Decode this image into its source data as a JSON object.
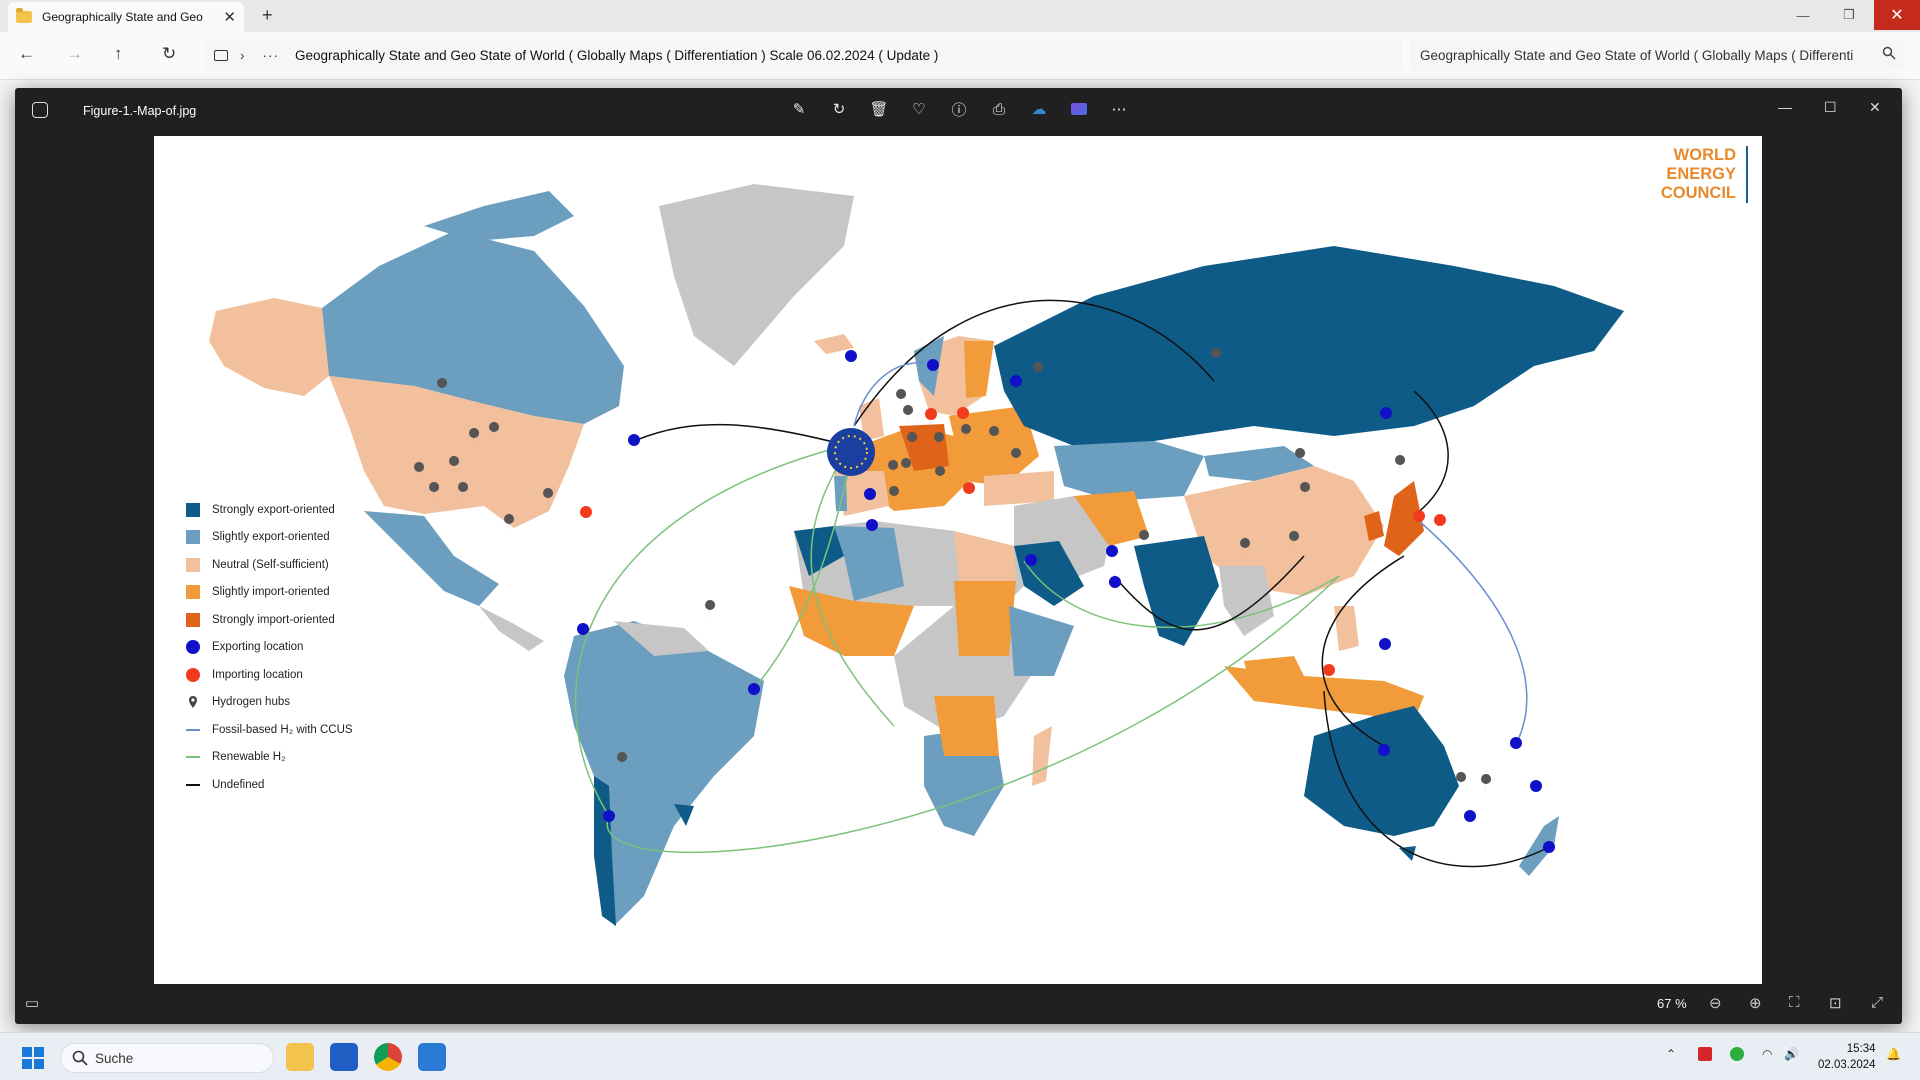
{
  "explorer": {
    "tab_title": "Geographically State and Geo",
    "address": "Geographically State and Geo State of World ( Globally Maps ( Differentiation ) Scale 06.02.2024 ( Update )",
    "search_text": "Geographically State and Geo State of World ( Globally Maps ( Differenti"
  },
  "viewer": {
    "filename": "Figure-1.-Map-of.jpg",
    "zoom": "67 %",
    "toolbar_icons": [
      "edit-image-icon",
      "rotate-icon",
      "delete-icon",
      "favorite-icon",
      "info-icon",
      "print-icon",
      "onedrive-icon",
      "clipchamp-icon",
      "more-icon"
    ]
  },
  "map": {
    "logo_lines": [
      "WORLD",
      "ENERGY",
      "COUNCIL"
    ],
    "legend": [
      {
        "label": "Strongly export-oriented",
        "kind": "swatch",
        "color": "#0d5b86"
      },
      {
        "label": "Slightly export-oriented",
        "kind": "swatch",
        "color": "#6b9ebf"
      },
      {
        "label": "Neutral (Self-sufficient)",
        "kind": "swatch",
        "color": "#f2c09c"
      },
      {
        "label": "Slightly import-oriented",
        "kind": "swatch",
        "color": "#f29b3a"
      },
      {
        "label": "Strongly import-oriented",
        "kind": "swatch",
        "color": "#e0631a"
      },
      {
        "label": "Exporting location",
        "kind": "dot",
        "color": "#1010c8"
      },
      {
        "label": "Importing location",
        "kind": "dot",
        "color": "#f23a1d"
      },
      {
        "label": "Hydrogen hubs",
        "kind": "pin",
        "color": "#444444"
      },
      {
        "label": "Fossil-based H₂ with CCUS",
        "kind": "line",
        "color": "#6a8fcf"
      },
      {
        "label": "Renewable H₂",
        "kind": "line",
        "color": "#7cc27c"
      },
      {
        "label": "Undefined",
        "kind": "line",
        "color": "#111111"
      }
    ]
  },
  "taskbar": {
    "search_placeholder": "Suche",
    "time": "15:34",
    "date": "02.03.2024"
  }
}
